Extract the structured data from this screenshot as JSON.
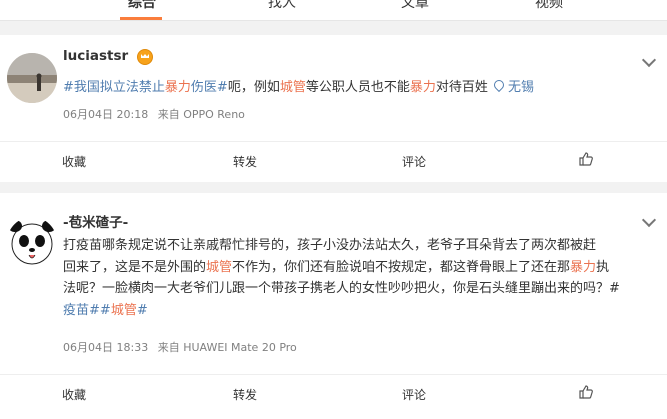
{
  "tabs": [
    {
      "label": "综合"
    },
    {
      "label": "找人"
    },
    {
      "label": "文章"
    },
    {
      "label": "视频"
    }
  ],
  "posts": [
    {
      "username": "luciastsr",
      "body": {
        "tag_open": "#我国拟立法禁止",
        "kw1": "暴力",
        "tag_close": "伤医#",
        "t1": "呃，例如",
        "kw2": "城管",
        "t2": "等公职人员也不能",
        "kw3": "暴力",
        "t3": "对待百姓",
        "location": "无锡"
      },
      "time": "06月04日 20:18",
      "source": "来自 OPPO Reno",
      "actions": {
        "collect": "收藏",
        "repost": "转发",
        "comment": "评论"
      }
    },
    {
      "username": "-苞米碴子-",
      "body": {
        "line1": "打疫苗哪条规定说不让亲戚帮忙排号的，孩子小没办法站太久，老爷子耳朵背去了两次都被赶",
        "line2_a": "回来了，这是不是外围的",
        "line2_kw1": "城管",
        "line2_b": "不作为，你们还有脸说咱不按规定，都这脊骨眼上了还在那",
        "line2_kw2": "暴力",
        "line2_c": "执",
        "line3": "法呢？一脸横肉一大老爷们儿跟一个带孩子携老人的女性吵吵把火，你是石头缝里蹦出来的吗？#",
        "line4_tag": "疫苗#",
        "line4_tag2a": "#",
        "line4_kw": "城管",
        "line4_tag2b": "#"
      },
      "time": "06月04日 18:33",
      "source": "来自 HUAWEI Mate 20 Pro",
      "actions": {
        "collect": "收藏",
        "repost": "转发",
        "comment": "评论"
      }
    }
  ]
}
